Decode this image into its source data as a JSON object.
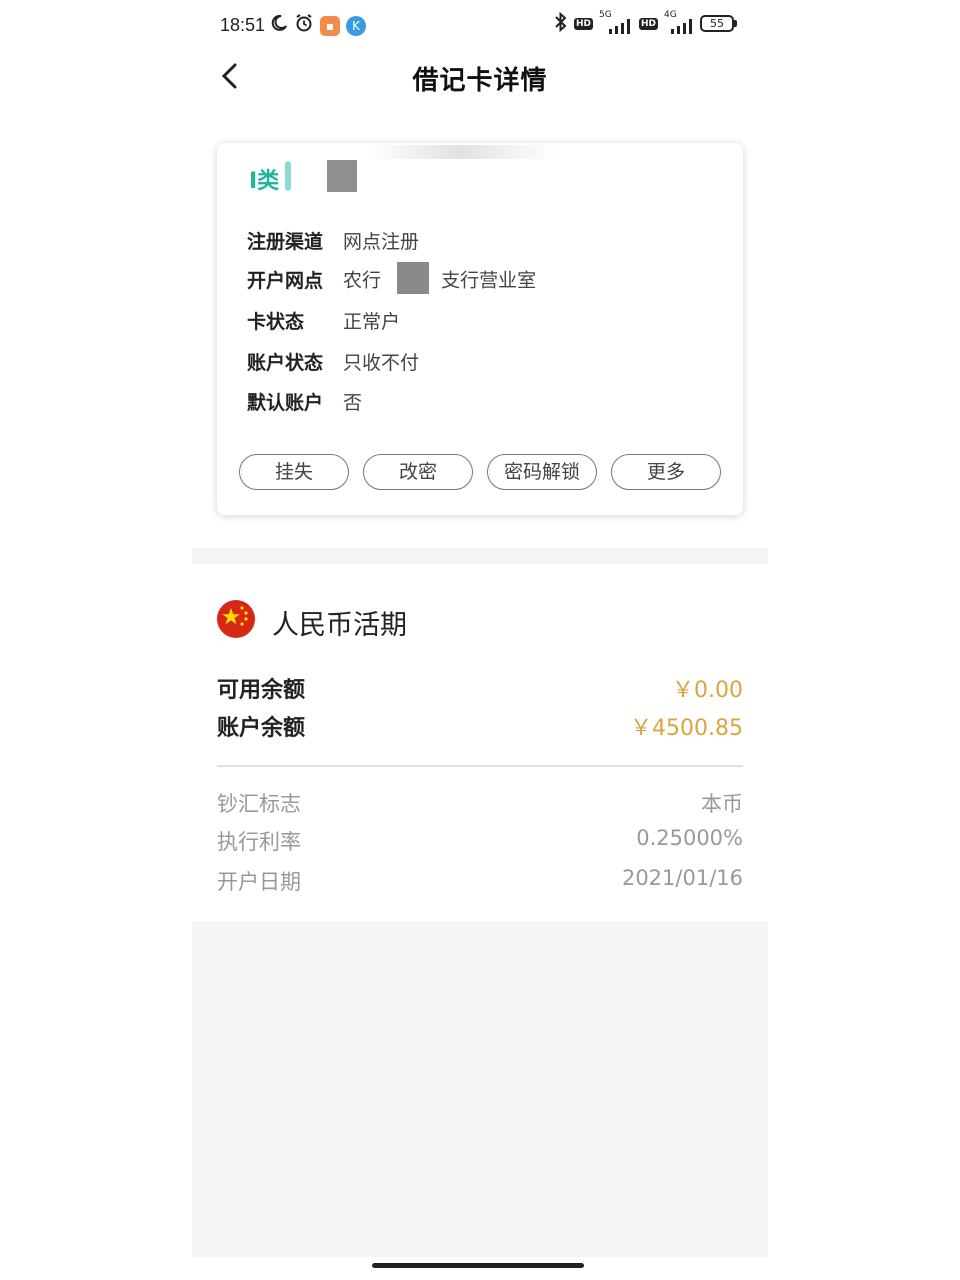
{
  "status_bar": {
    "time": "18:51",
    "battery": "55",
    "network_1": "5G",
    "network_2": "4G",
    "hd": "HD"
  },
  "header": {
    "title": "借记卡详情",
    "back_icon": "chevron-left-icon"
  },
  "card": {
    "type_label": "I类",
    "rows": [
      {
        "label": "注册渠道",
        "value": "网点注册"
      },
      {
        "label": "开户网点",
        "value_prefix": "农行",
        "value_suffix": "支行营业室"
      },
      {
        "label": "卡状态",
        "value": "正常户"
      },
      {
        "label": "账户状态",
        "value": "只收不付"
      },
      {
        "label": "默认账户",
        "value": "否"
      }
    ],
    "actions": [
      "挂失",
      "改密",
      "密码解锁",
      "更多"
    ]
  },
  "account": {
    "flag_icon": "china-flag-icon",
    "name": "人民币活期",
    "balances": [
      {
        "label": "可用余额",
        "value": "￥0.00"
      },
      {
        "label": "账户余额",
        "value": "￥4500.85"
      }
    ],
    "details": [
      {
        "label": "钞汇标志",
        "value": "本币"
      },
      {
        "label": "执行利率",
        "value": "0.25000%"
      },
      {
        "label": "开户日期",
        "value": "2021/01/16"
      }
    ]
  },
  "colors": {
    "accent_teal": "#1fb5a0",
    "amount_gold": "#d8a640",
    "flag_red": "#d62718"
  }
}
